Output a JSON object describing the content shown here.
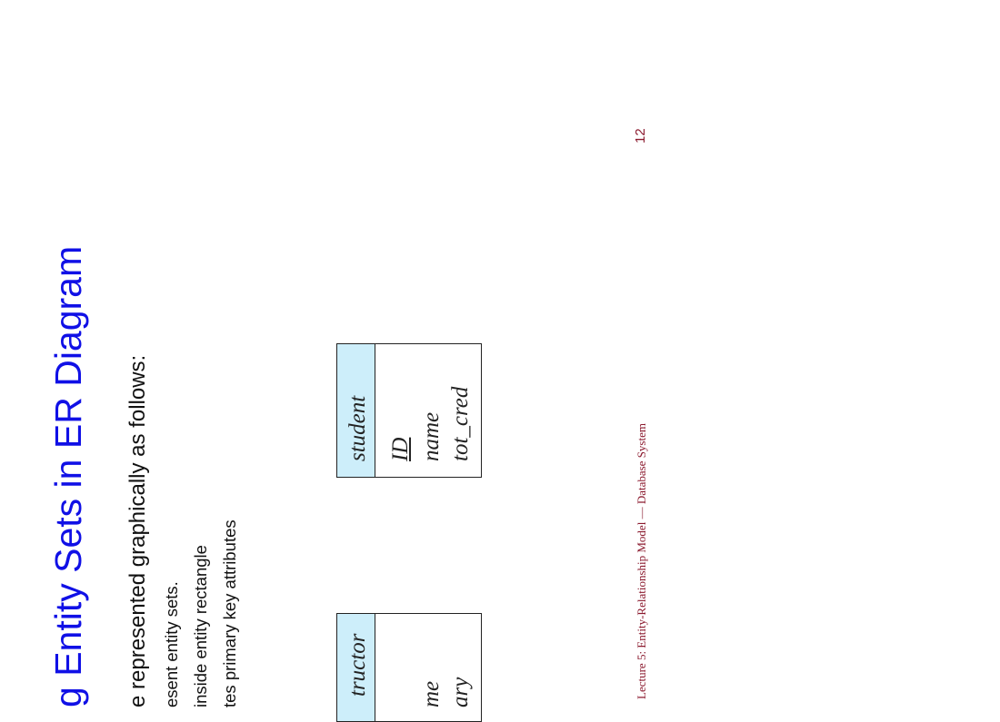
{
  "slide": {
    "title": "g Entity Sets in ER Diagram",
    "intro": "e represented graphically as follows:",
    "bullets": [
      "esent entity sets.",
      "inside entity rectangle",
      "tes primary key attributes"
    ],
    "footer": "Lecture 5: Entity-Relationship Model — Database System",
    "page_number": "12"
  },
  "entities": {
    "instructor": {
      "name": "tructor",
      "attributes": [
        "me",
        "ary"
      ]
    },
    "student": {
      "name": "student",
      "attributes": [
        {
          "text": "ID",
          "primary_key": true
        },
        {
          "text": "name",
          "primary_key": false
        },
        {
          "text": "tot_cred",
          "primary_key": false
        }
      ]
    }
  },
  "colors": {
    "title": "#1010e6",
    "header_fill": "#cdeefa",
    "footer": "#8b1a2e"
  }
}
